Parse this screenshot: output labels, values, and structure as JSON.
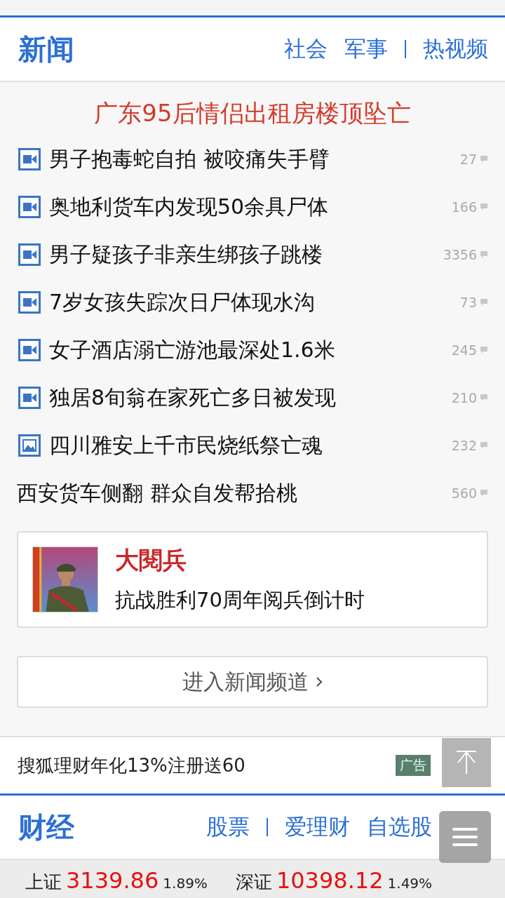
{
  "news_section": {
    "title": "新闻",
    "links": [
      {
        "label": "社会",
        "separator_before": false
      },
      {
        "label": "军事",
        "separator_before": false
      },
      {
        "label": "热视频",
        "separator_before": true
      }
    ]
  },
  "headline": "广东95后情侣出租房楼顶坠亡",
  "news_items": [
    {
      "kind": "video",
      "title": "男子抱毒蛇自拍 被咬痛失手臂",
      "comments": "27"
    },
    {
      "kind": "video",
      "title": "奥地利货车内发现50余具尸体",
      "comments": "166"
    },
    {
      "kind": "video",
      "title": "男子疑孩子非亲生绑孩子跳楼",
      "comments": "3356"
    },
    {
      "kind": "video",
      "title": "7岁女孩失踪次日尸体现水沟",
      "comments": "73"
    },
    {
      "kind": "video",
      "title": "女子酒店溺亡游池最深处1.6米",
      "comments": "245"
    },
    {
      "kind": "video",
      "title": "独居8旬翁在家死亡多日被发现",
      "comments": "210"
    },
    {
      "title": "四川雅安上千市民烧纸祭亡魂",
      "comments": "232"
    },
    {
      "kind": "text",
      "title": "西安货车侧翻 群众自发帮拾桃",
      "comments": "560"
    }
  ],
  "promo_card": {
    "title": "大閱兵",
    "subtitle": "抗战胜利70周年阅兵倒计时"
  },
  "channel_button": {
    "label": "进入新闻频道"
  },
  "ad": {
    "text": "搜狐理财年化13%注册送60",
    "badge": "广告"
  },
  "finance_section": {
    "title": "财经",
    "links": [
      {
        "label": "股票",
        "separator_before": false
      },
      {
        "label": "爱理财",
        "separator_before": true
      },
      {
        "label": "自选股",
        "separator_before": false
      }
    ]
  },
  "indices": [
    {
      "name": "上证",
      "value": "3139.86",
      "change": "1.89%"
    },
    {
      "name": "深证",
      "value": "10398.12",
      "change": "1.49%"
    }
  ]
}
